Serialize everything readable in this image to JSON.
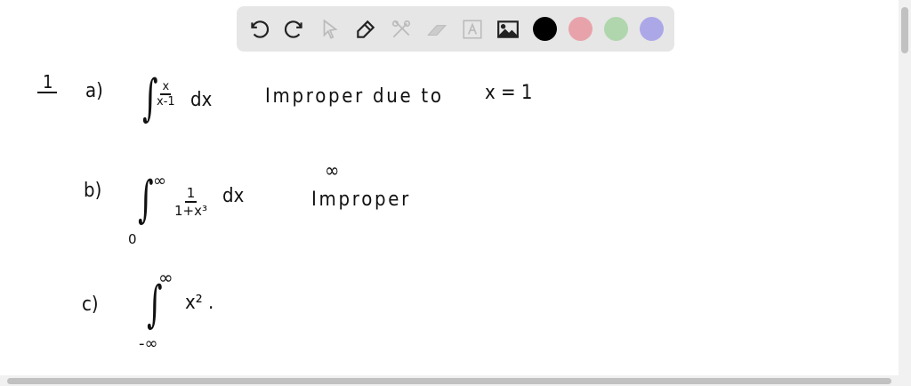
{
  "toolbar": {
    "tools": [
      "undo-icon",
      "redo-icon",
      "select-icon",
      "pen-icon",
      "tools-icon",
      "eraser-icon",
      "text-icon",
      "image-icon"
    ],
    "colors": [
      "#000000",
      "#e8a3aa",
      "#b0d6ae",
      "#aca8e8"
    ]
  },
  "board": {
    "problem_number": "1",
    "a": {
      "label": "a)",
      "integrand_num": "x",
      "integrand_den": "x-1",
      "dx": "dx",
      "note": "Improper due to",
      "cond": "x = 1"
    },
    "b": {
      "label": "b)",
      "lower": "0",
      "upper": "∞",
      "integrand_num": "1",
      "integrand_den": "1+x³",
      "dx": "dx",
      "note_top": "∞",
      "note": "Improper"
    },
    "c": {
      "label": "c)",
      "lower": "-∞",
      "upper": "∞",
      "integrand": "x² ."
    }
  }
}
